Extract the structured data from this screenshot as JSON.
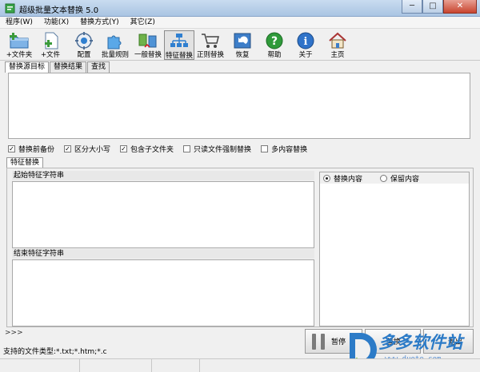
{
  "window": {
    "title": "超级批量文本替换 5.0",
    "min_glyph": "─",
    "max_glyph": "□",
    "close_glyph": "✕"
  },
  "menu": [
    "程序(W)",
    "功能(X)",
    "替换方式(Y)",
    "其它(Z)"
  ],
  "toolbar": [
    {
      "label": "+文件夹",
      "icon": "add-folder-icon"
    },
    {
      "label": "+文件",
      "icon": "add-file-icon"
    },
    {
      "label": "配置",
      "icon": "config-icon"
    },
    {
      "label": "批量规则",
      "icon": "puzzle-icon"
    },
    {
      "label": "一般替换",
      "icon": "swap-icon"
    },
    {
      "label": "特征替换",
      "icon": "tree-icon"
    },
    {
      "label": "正则替换",
      "icon": "cart-icon"
    },
    {
      "label": "恢复",
      "icon": "undo-icon"
    },
    {
      "label": "帮助",
      "icon": "help-icon"
    },
    {
      "label": "关于",
      "icon": "info-icon"
    },
    {
      "label": "主页",
      "icon": "home-icon"
    }
  ],
  "top_tabs": [
    "替换源目标",
    "替换结果",
    "查找"
  ],
  "options": [
    {
      "label": "替换前备份",
      "checked": true
    },
    {
      "label": "区分大小写",
      "checked": true
    },
    {
      "label": "包含子文件夹",
      "checked": true
    },
    {
      "label": "只读文件强制替换",
      "checked": false
    },
    {
      "label": "多内容替换",
      "checked": false
    }
  ],
  "feature_tab": "特征替换",
  "start_label": "起始特征字符串",
  "end_label": "结束特征字符串",
  "radios": [
    {
      "label": "替换内容",
      "selected": true
    },
    {
      "label": "保留内容",
      "selected": false
    }
  ],
  "log_prompt": ">>>",
  "pause_label": "暂停",
  "replace_label": "替换",
  "exit_label": "退出",
  "file_types": "支持的文件类型:*.txt;*.htm;*.c",
  "watermark": {
    "big": "多多软件站",
    "small": "www.duote.com"
  },
  "colors": {
    "title_bar": "#b4cbe6",
    "close_button": "#c8442e",
    "watermark": "#2c7bc7"
  }
}
